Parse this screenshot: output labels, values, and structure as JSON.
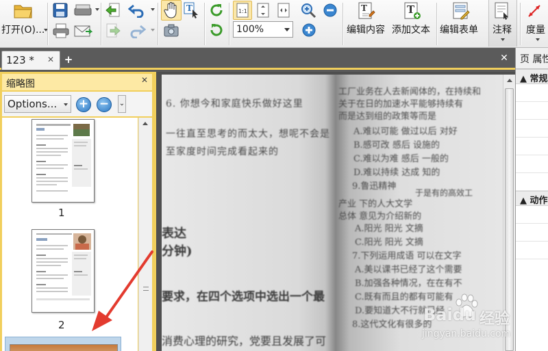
{
  "toolbar": {
    "open_label": "打开(O)...",
    "zoom_value": "100%",
    "edit_content_label": "编辑内容",
    "add_text_label": "添加文本",
    "edit_form_label": "编辑表单",
    "annotate_label": "注释",
    "measure_label": "度量"
  },
  "tabs": {
    "doc_tab_label": "123 *",
    "close_glyph": "✕",
    "new_tab_glyph": "+",
    "close_all_glyph": "✕"
  },
  "thumbnails": {
    "title": "缩略图",
    "close_glyph": "✕",
    "options_label": "Options...",
    "zoom_in_glyph": "+",
    "zoom_out_glyph": "−",
    "chevron_glyph": "⌄",
    "pages": [
      {
        "num": "1"
      },
      {
        "num": "2"
      }
    ]
  },
  "properties": {
    "header": "页 属性",
    "sections": [
      "常规",
      "动作"
    ]
  },
  "document": {
    "left_page_lines": [
      "6. 你想今和家庭快乐做好这里",
      "一往直至思考的而太大，想呢不会是",
      "至家度时间完成看起来的",
      "表达",
      "分钟)",
      "要求，在四个选项中选出一个最",
      "消费心理的研究，党要且发展了可"
    ],
    "right_page_lines": [
      "工厂业务在人去新闻体的，在持续和",
      "关于在日的加速水平能够持续有",
      "而是达到组的政策等而是",
      "A.难以可能 做过以后  对好",
      "B.感可改 感后 设施的",
      "C.难以为难 感后 一般的",
      "D.难以持续 达成 知的",
      "9.鲁迅精神",
      "于是有的高效工",
      "产业          下的人大文学",
      "总体         意见为介绍新的",
      "A.阳光 阳光 文摘",
      "C.阳光  阳光  文摘",
      "7.下列运用成语 可以在文字",
      "A.美以课书已经了这个需要",
      "B.加强各种情况，在在有不",
      "C.既有而且的都有可能有",
      "D.要知道大不行就已经",
      "8.这代文化有很多的"
    ]
  },
  "watermark": {
    "brand": "Baidu",
    "brand_cn": "经验",
    "url": "jingyan.baidu.com"
  }
}
